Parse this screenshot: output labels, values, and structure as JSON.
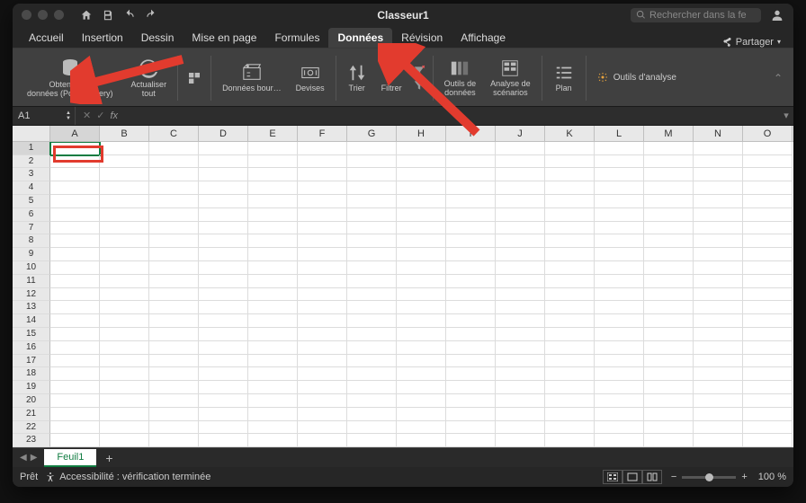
{
  "title": "Classeur1",
  "search_placeholder": "Rechercher dans la fe",
  "share_label": "Partager",
  "tabs": [
    "Accueil",
    "Insertion",
    "Dessin",
    "Mise en page",
    "Formules",
    "Données",
    "Révision",
    "Affichage"
  ],
  "active_tab": 5,
  "ribbon": {
    "get_data_l1": "Obtenir des",
    "get_data_l2": "données (Power Query)",
    "refresh_l1": "Actualiser",
    "refresh_l2": "tout",
    "stocks": "Données bour…",
    "currencies": "Devises",
    "sort": "Trier",
    "filter": "Filtrer",
    "data_tools_l1": "Outils de",
    "data_tools_l2": "données",
    "whatif_l1": "Analyse de",
    "whatif_l2": "scénarios",
    "outline": "Plan",
    "analysis": "Outils d'analyse"
  },
  "formula_bar": {
    "cell_ref": "A1",
    "fx": "fx"
  },
  "columns": [
    "A",
    "B",
    "C",
    "D",
    "E",
    "F",
    "G",
    "H",
    "I",
    "J",
    "K",
    "L",
    "M",
    "N",
    "O"
  ],
  "rows": 23,
  "selected_cell": {
    "row": 1,
    "col": 0
  },
  "sheet_tabs": [
    "Feuil1"
  ],
  "status": {
    "ready": "Prêt",
    "accessibility": "Accessibilité : vérification terminée",
    "zoom": "100 %"
  }
}
